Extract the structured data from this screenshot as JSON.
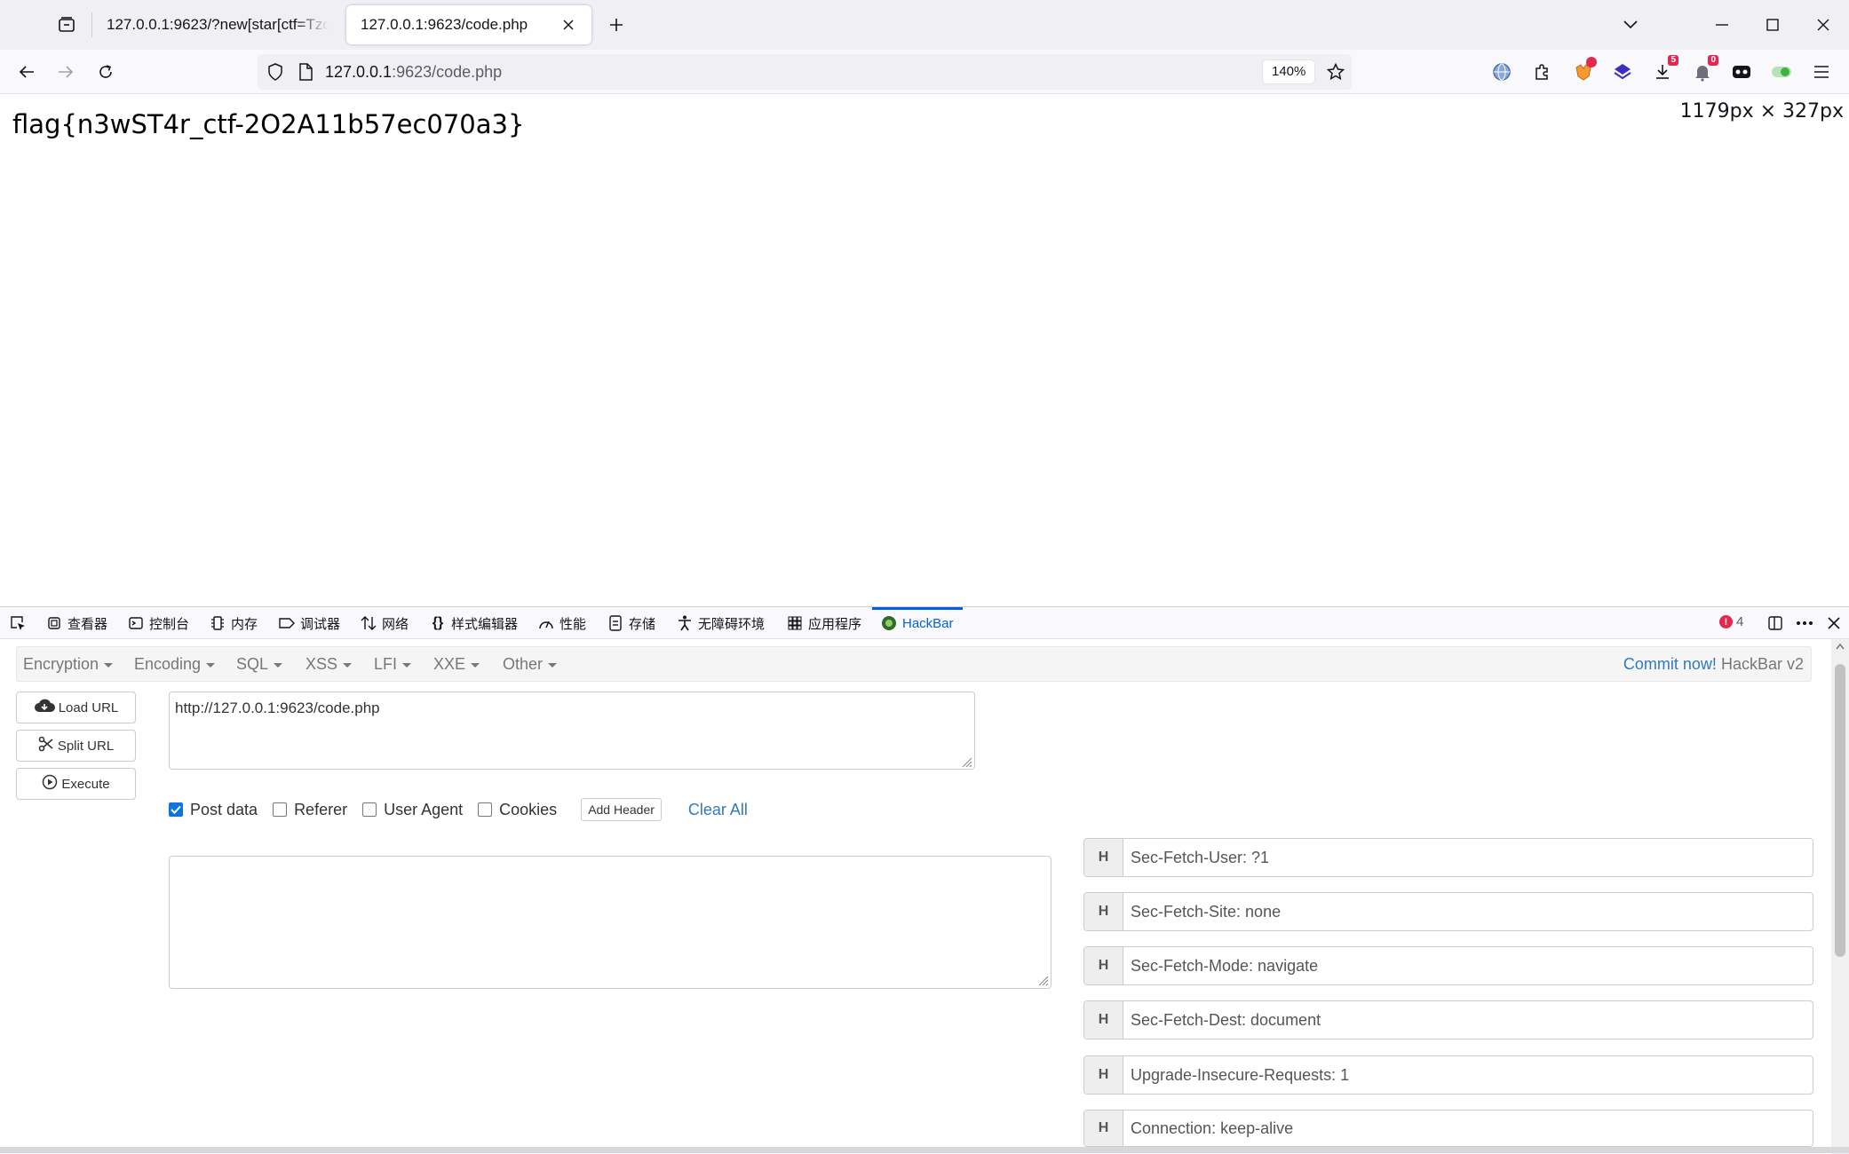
{
  "browser": {
    "tabs": [
      {
        "title": "127.0.0.1:9623/?new[star[ctf=Tzo",
        "active": false
      },
      {
        "title": "127.0.0.1:9623/code.php",
        "active": true
      }
    ],
    "url_host": "127.0.0.1",
    "url_rest": ":9623/code.php",
    "zoom": "140%",
    "extensions": [
      {
        "name": "globe-extension-icon"
      },
      {
        "name": "puzzle-extensions-icon"
      },
      {
        "name": "fox-extension-icon",
        "badge": ""
      },
      {
        "name": "layers-extension-icon"
      },
      {
        "name": "download-extension-icon",
        "badge": "5"
      },
      {
        "name": "bell-extension-icon",
        "badge": "0"
      },
      {
        "name": "mask-extension-icon"
      },
      {
        "name": "toggle-extension-icon"
      }
    ]
  },
  "page": {
    "flag_text": "flag{n3wST4r_ctf-2O2A11b57ec070a3}",
    "dimensions_text": "1179px × 327px"
  },
  "devtools": {
    "tabs": [
      "查看器",
      "控制台",
      "内存",
      "调试器",
      "网络",
      "样式编辑器",
      "性能",
      "存储",
      "无障碍环境",
      "应用程序",
      "HackBar"
    ],
    "error_count": "4"
  },
  "hackbar": {
    "menu": [
      "Encryption",
      "Encoding",
      "SQL",
      "XSS",
      "LFI",
      "XXE",
      "Other"
    ],
    "commit_link": "Commit now!",
    "version": "HackBar v2",
    "buttons": {
      "load": "Load URL",
      "split": "Split URL",
      "execute": "Execute"
    },
    "url_value": "http://127.0.0.1:9623/code.php",
    "options": {
      "post_data": "Post data",
      "referer": "Referer",
      "user_agent": "User Agent",
      "cookies": "Cookies",
      "post_data_checked": true,
      "referer_checked": false,
      "user_agent_checked": false,
      "cookies_checked": false
    },
    "add_header": "Add Header",
    "clear_all": "Clear All",
    "post_body": "",
    "header_marker": "H",
    "headers": [
      "Sec-Fetch-User: ?1",
      "Sec-Fetch-Site: none",
      "Sec-Fetch-Mode: navigate",
      "Sec-Fetch-Dest: document",
      "Upgrade-Insecure-Requests: 1",
      "Connection: keep-alive"
    ]
  }
}
